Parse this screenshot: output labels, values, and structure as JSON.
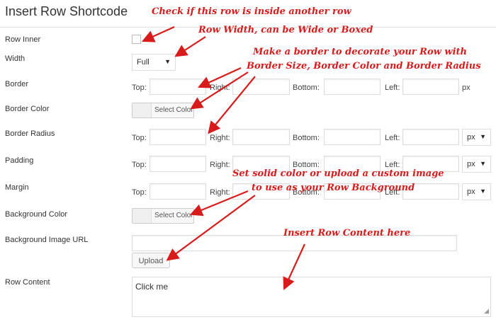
{
  "title": "Insert Row Shortcode",
  "fields": {
    "row_inner": "Row Inner",
    "width": "Width",
    "border": "Border",
    "border_color": "Border Color",
    "border_radius": "Border Radius",
    "padding": "Padding",
    "margin": "Margin",
    "background_color": "Background Color",
    "background_image_url": "Background Image URL",
    "row_content": "Row Content"
  },
  "sides": {
    "top": "Top:",
    "right": "Right:",
    "bottom": "Bottom:",
    "left": "Left:"
  },
  "unit_px": "px",
  "width_select": {
    "value": "Full"
  },
  "select_color_label": "Select Color",
  "upload_label": "Upload",
  "row_content_value": "Click me",
  "annotations": {
    "row_inner": "Check if this row is inside another row",
    "width": "Row Width, can be Wide or Boxed",
    "border_line1": "Make a border to decorate your Row with",
    "border_line2": "Border Size, Border Color and Border Radius",
    "bg_line1": "Set solid color or upload a custom image",
    "bg_line2": "to use as your Row Background",
    "content": "Insert Row Content here"
  },
  "colors": {
    "annotation": "#d81b1b"
  }
}
